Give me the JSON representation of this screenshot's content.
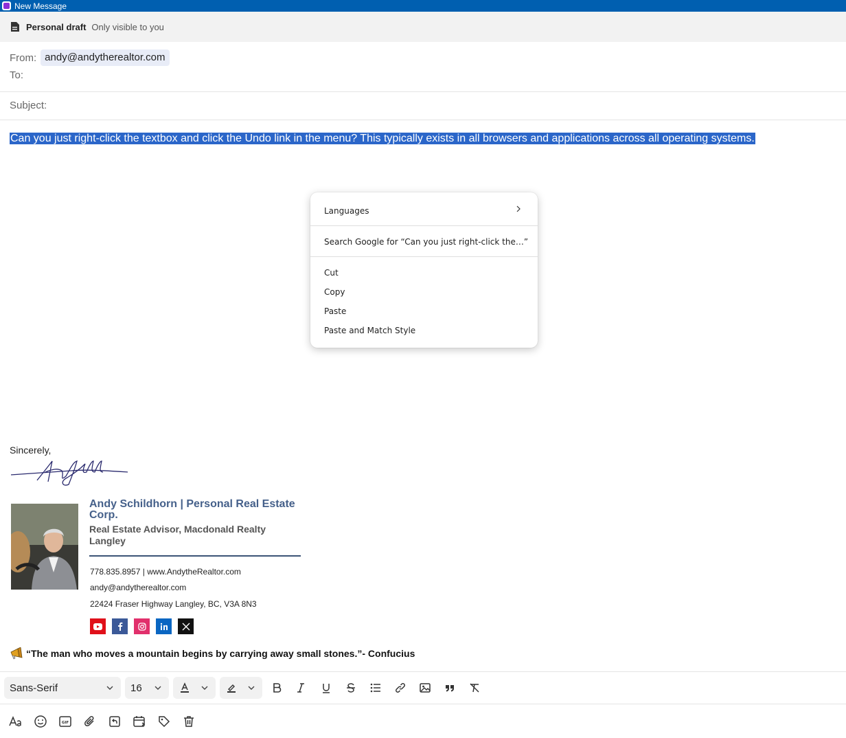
{
  "window": {
    "title": "New Message"
  },
  "draft_bar": {
    "title": "Personal draft",
    "subtitle": "Only visible to you"
  },
  "fields": {
    "from_label": "From:",
    "from_value": "andy@andytherealtor.com",
    "to_label": "To:",
    "subject_label": "Subject:"
  },
  "body": {
    "selected_text": "Can you just right-click the textbox and click the Undo link in the menu? This typically exists in all browsers and applications across all operating systems."
  },
  "context_menu": {
    "items": [
      {
        "label": "Languages",
        "has_submenu": true
      },
      {
        "label": "Search Google for “Can you just right-click the…”"
      },
      {
        "label": "Cut"
      },
      {
        "label": "Copy"
      },
      {
        "label": "Paste"
      },
      {
        "label": "Paste and Match Style"
      }
    ]
  },
  "signature": {
    "closing": "Sincerely,",
    "name": "Andy Schildhorn | Personal Real Estate Corp.",
    "role": "Real Estate Advisor, Macdonald Realty Langley",
    "phone_web": "778.835.8957  |  www.AndytheRealtor.com",
    "email": "andy@andytherealtor.com",
    "address": "22424 Fraser Highway Langley, BC, V3A 8N3",
    "social": [
      "youtube-icon",
      "facebook-icon",
      "instagram-icon",
      "linkedin-icon",
      "x-icon"
    ],
    "quote": "“The man who moves a mountain begins by carrying away small stones.”- Confucius"
  },
  "toolbar": {
    "font_family": "Sans-Serif",
    "font_size": "16",
    "format_icons": [
      "text-color-icon",
      "highlight-icon",
      "bold-icon",
      "italic-icon",
      "underline-icon",
      "strikethrough-icon",
      "bullet-list-icon",
      "link-icon",
      "image-icon",
      "quote-icon",
      "clear-format-icon"
    ],
    "bottom_icons": [
      "formatting-icon",
      "emoji-icon",
      "gif-icon",
      "attach-icon",
      "undo-send-icon",
      "schedule-icon",
      "tag-icon",
      "delete-icon"
    ]
  },
  "colors": {
    "titlebar": "#005fb0",
    "selection": "#2b66c9",
    "signature_name": "#45608a"
  }
}
